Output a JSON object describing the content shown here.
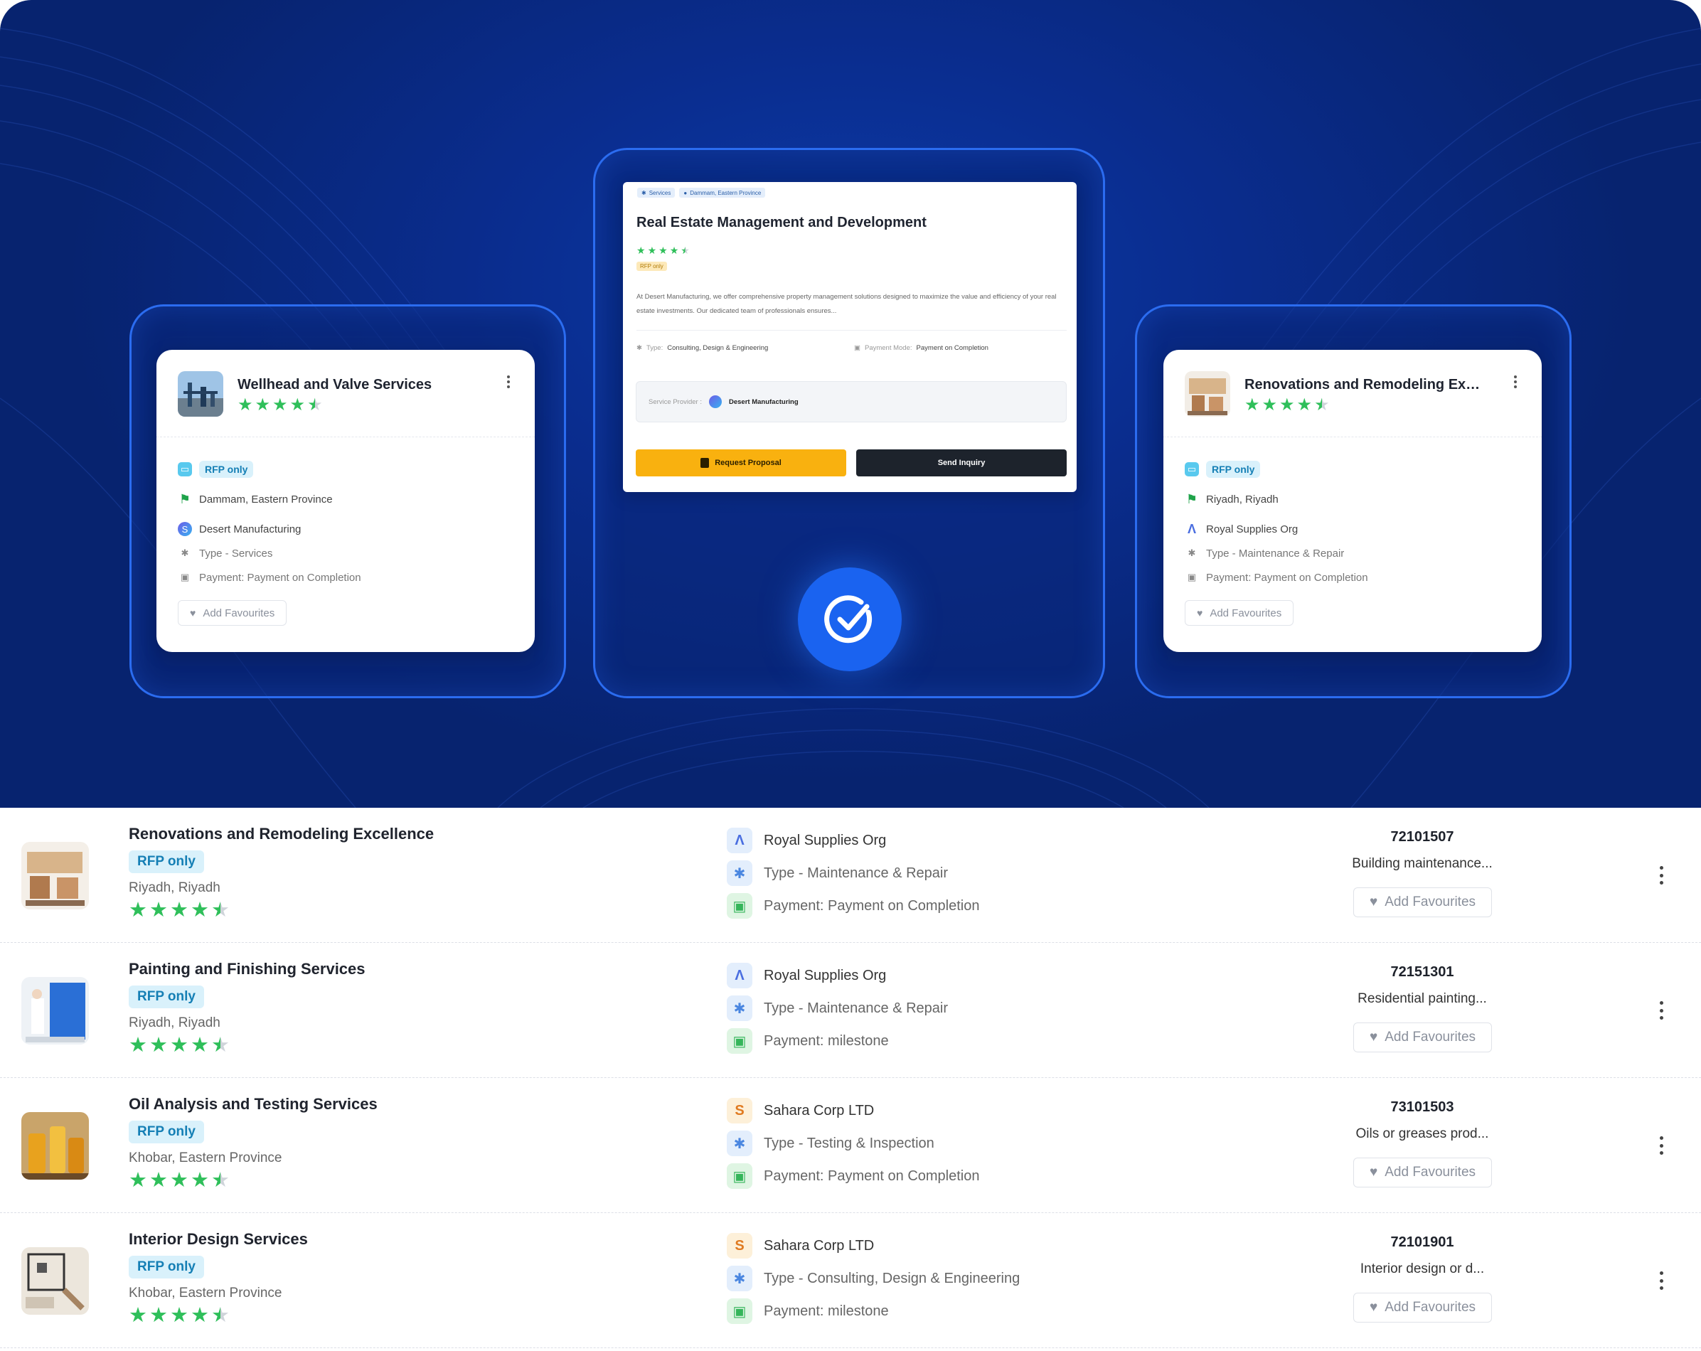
{
  "left_card": {
    "title": "Wellhead and Valve Services",
    "rating": 4.5,
    "badge": "RFP only",
    "location": "Dammam, Eastern Province",
    "provider": "Desert Manufacturing",
    "type": "Type - Services",
    "payment": "Payment: Payment on Completion",
    "fav": "Add Favourites"
  },
  "center_card": {
    "tag_category": "Services",
    "tag_location": "Dammam, Eastern Province",
    "title": "Real Estate Management and Development",
    "rating": 4.5,
    "badge": "RFP only",
    "description": "At Desert Manufacturing, we offer comprehensive property management solutions designed to maximize the value and efficiency of your real estate investments. Our dedicated team of professionals ensures...",
    "type_label": "Type:",
    "type_value": "Consulting, Design & Engineering",
    "payment_label": "Payment Mode:",
    "payment_value": "Payment on Completion",
    "provider_label": "Service Provider :",
    "provider_name": "Desert Manufacturing",
    "request_btn": "Request Proposal",
    "inquiry_btn": "Send Inquiry"
  },
  "right_card": {
    "title": "Renovations and Remodeling Excell...",
    "rating": 4.5,
    "badge": "RFP only",
    "location": "Riyadh, Riyadh",
    "provider": "Royal Supplies Org",
    "type": "Type - Maintenance & Repair",
    "payment": "Payment: Payment on Completion",
    "fav": "Add Favourites"
  },
  "list": [
    {
      "title": "Renovations and Remodeling Excellence",
      "badge": "RFP only",
      "location": "Riyadh, Riyadh",
      "rating": 4.5,
      "provider": "Royal Supplies Org",
      "type": "Type - Maintenance & Repair",
      "payment": "Payment: Payment on Completion",
      "code": "72101507",
      "desc": "Building maintenance...",
      "fav": "Add Favourites"
    },
    {
      "title": "Painting and Finishing Services",
      "badge": "RFP only",
      "location": "Riyadh, Riyadh",
      "rating": 4.5,
      "provider": "Royal Supplies Org",
      "type": "Type - Maintenance & Repair",
      "payment": "Payment: milestone",
      "code": "72151301",
      "desc": "Residential painting...",
      "fav": "Add Favourites"
    },
    {
      "title": "Oil Analysis and Testing Services",
      "badge": "RFP only",
      "location": "Khobar, Eastern Province",
      "rating": 4.5,
      "provider": "Sahara Corp LTD",
      "type": "Type - Testing & Inspection",
      "payment": "Payment: Payment on Completion",
      "code": "73101503",
      "desc": "Oils or greases prod...",
      "fav": "Add Favourites"
    },
    {
      "title": "Interior Design Services",
      "badge": "RFP only",
      "location": "Khobar, Eastern Province",
      "rating": 4.5,
      "provider": "Sahara Corp LTD",
      "type": "Type - Consulting, Design & Engineering",
      "payment": "Payment: milestone",
      "code": "72101901",
      "desc": "Interior design or d...",
      "fav": "Add Favourites"
    }
  ],
  "colors": {
    "hero_bg": "#0a2d8f",
    "frame": "#2b6cf0",
    "star": "#2fbf5a",
    "badge_bg": "#d9f1fb",
    "badge_text": "#157fb5",
    "request_btn": "#f9b10f",
    "inquiry_btn": "#1d232c"
  }
}
